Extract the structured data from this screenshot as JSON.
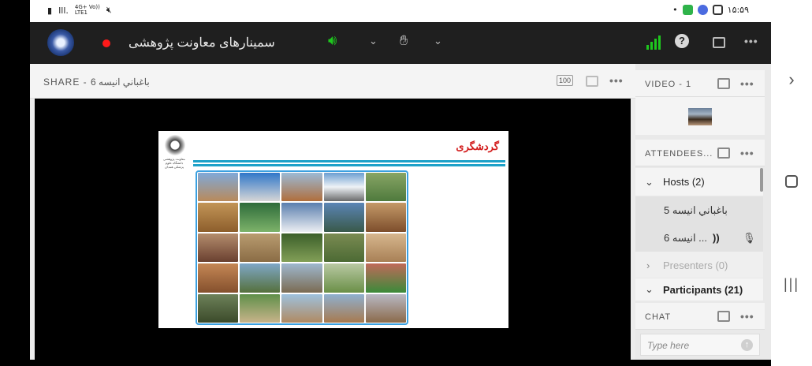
{
  "status_bar": {
    "net_line_1": "4G+ Vo))",
    "net_line_2": "LTE1",
    "time": "۱۵:۵۹"
  },
  "meeting": {
    "room_title": "سمینارهای معاونت پژوهشی"
  },
  "share_pod": {
    "title": "SHARE - باغباني انيسه 6",
    "zoom_label": "100"
  },
  "slide": {
    "title": "گردشگری",
    "emblem_caption": "معاونت پژوهشی دانشگاه علوم پزشکی همدان"
  },
  "video_pod": {
    "title": "VIDEO - 1"
  },
  "attendees_pod": {
    "title": "ATTENDEES...",
    "hosts_label": "Hosts (2)",
    "host_1": "باغباني انيسه 5",
    "host_2": "... انيسه 6",
    "presenters_label": "Presenters (0)",
    "participants_label": "Participants (21)"
  },
  "chat_pod": {
    "title": "CHAT",
    "placeholder": "Type here"
  },
  "colors": {
    "accent_green": "#1ec71e",
    "record_red": "#ff1a1a",
    "slide_title_red": "#d21a1a",
    "slide_line_blue": "#1da1c8"
  }
}
